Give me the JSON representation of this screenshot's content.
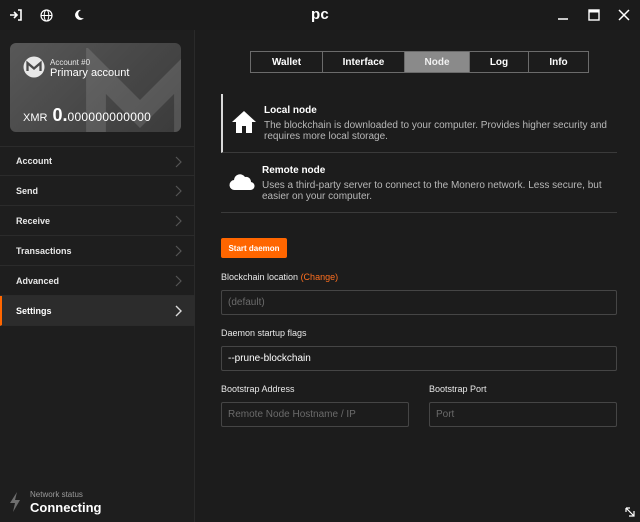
{
  "window": {
    "title": "pc"
  },
  "titlebar": {
    "icons": [
      "logout-icon",
      "globe-icon",
      "moon-icon"
    ],
    "controls": [
      "minimize-icon",
      "maximize-icon",
      "close-icon"
    ]
  },
  "account": {
    "number": "Account #0",
    "name": "Primary account",
    "currency": "XMR",
    "balance_main": "0.",
    "balance_rest": "000000000000"
  },
  "menu": {
    "items": [
      {
        "label": "Account",
        "active": false
      },
      {
        "label": "Send",
        "active": false
      },
      {
        "label": "Receive",
        "active": false
      },
      {
        "label": "Transactions",
        "active": false
      },
      {
        "label": "Advanced",
        "active": false
      },
      {
        "label": "Settings",
        "active": true
      }
    ]
  },
  "network": {
    "label": "Network status",
    "status": "Connecting"
  },
  "tabs": [
    {
      "label": "Wallet",
      "active": false
    },
    {
      "label": "Interface",
      "active": false
    },
    {
      "label": "Node",
      "active": true
    },
    {
      "label": "Log",
      "active": false
    },
    {
      "label": "Info",
      "active": false
    }
  ],
  "node": {
    "local": {
      "title": "Local node",
      "description": "The blockchain is downloaded to your computer. Provides higher security and requires more local storage.",
      "icon": "home-icon",
      "selected": true
    },
    "remote": {
      "title": "Remote node",
      "description": "Uses a third-party server to connect to the Monero network. Less secure, but easier on your computer.",
      "icon": "cloud-icon",
      "selected": false
    }
  },
  "daemon": {
    "start_label": "Start daemon",
    "blockchain_location_label": "Blockchain location",
    "change_label": "(Change)",
    "blockchain_location_value": "(default)",
    "flags_label": "Daemon startup flags",
    "flags_value": "--prune-blockchain",
    "bootstrap_address_label": "Bootstrap Address",
    "bootstrap_address_placeholder": "Remote Node Hostname / IP",
    "bootstrap_port_label": "Bootstrap Port",
    "bootstrap_port_placeholder": "Port"
  },
  "colors": {
    "accent": "#ff6600",
    "background": "#1c1c1c"
  }
}
